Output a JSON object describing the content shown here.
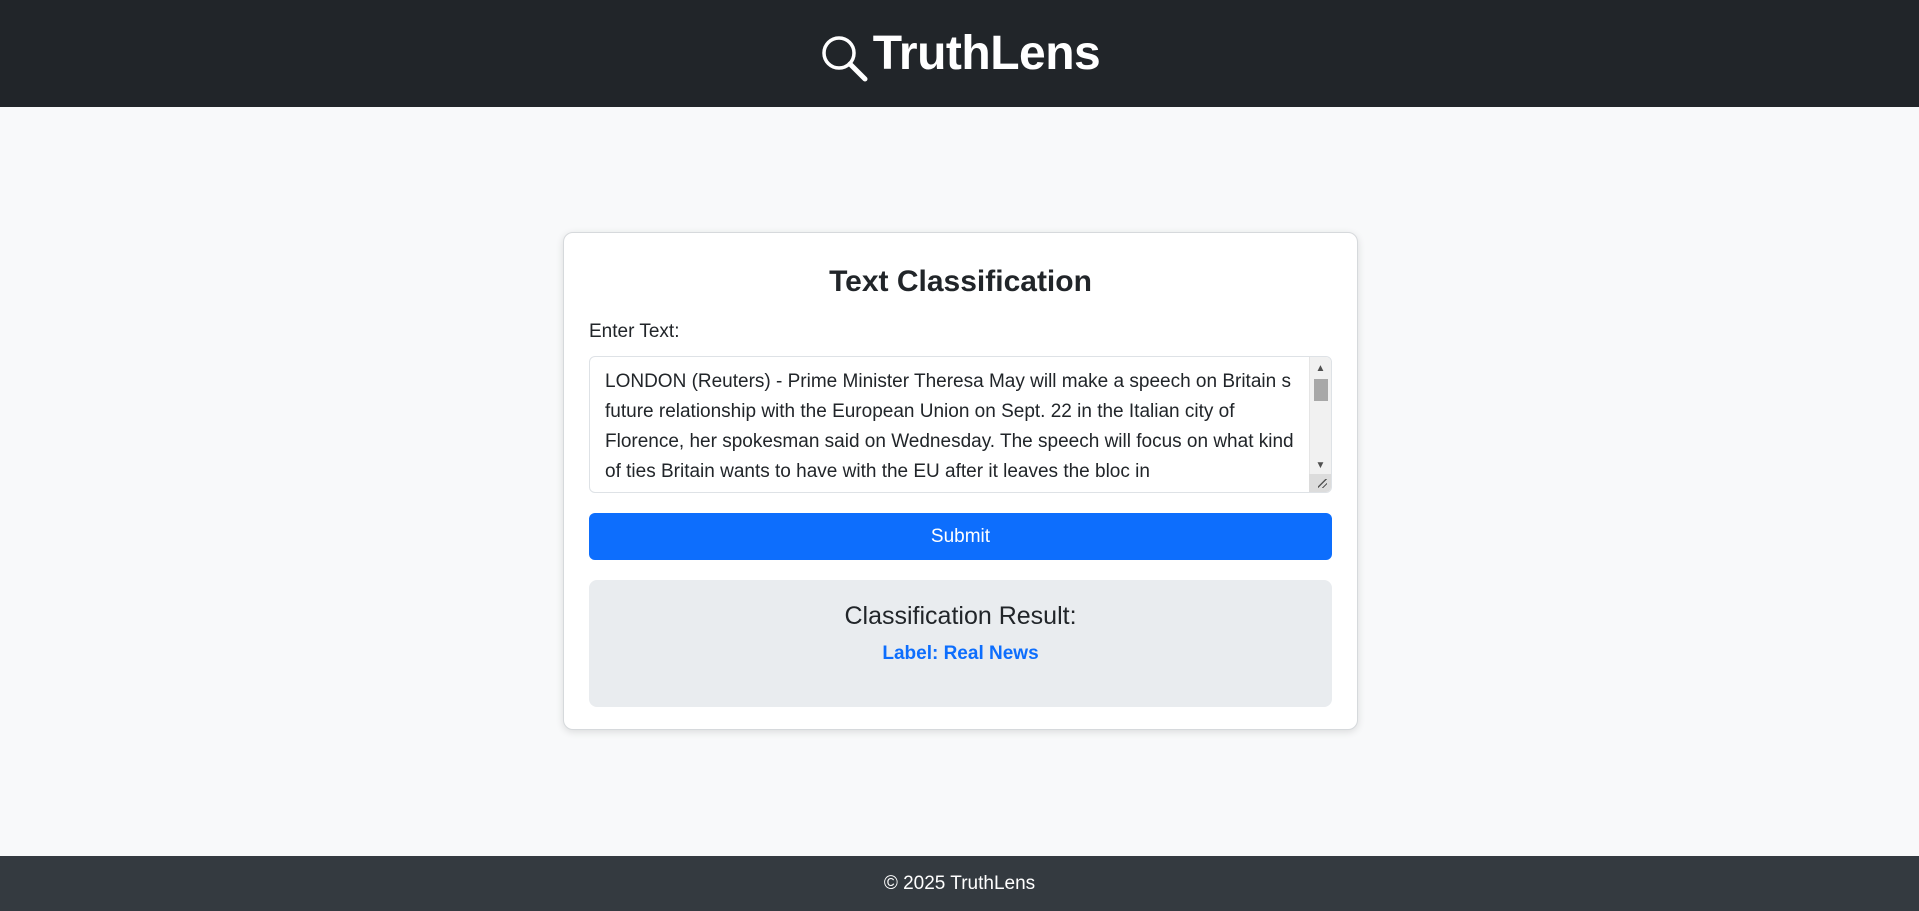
{
  "header": {
    "icon": "magnifier-icon",
    "title": "TruthLens"
  },
  "form": {
    "title": "Text Classification",
    "input_label": "Enter Text:",
    "text_value": "LONDON (Reuters) - Prime Minister Theresa May will make a speech on Britain s future relationship with the European Union on Sept. 22 in the Italian city of Florence, her spokesman said on Wednesday. The speech will focus on what kind of ties Britain wants to have with the EU after it leaves the bloc in",
    "submit_label": "Submit"
  },
  "result": {
    "heading": "Classification Result:",
    "label": "Label: Real News",
    "label_color": "#0d6efd"
  },
  "footer": {
    "text": "© 2025 TruthLens"
  },
  "colors": {
    "header_bg": "#212529",
    "footer_bg": "#343a40",
    "primary": "#0d6efd",
    "page_bg": "#f8f9fa",
    "result_bg": "#e9ecef"
  }
}
